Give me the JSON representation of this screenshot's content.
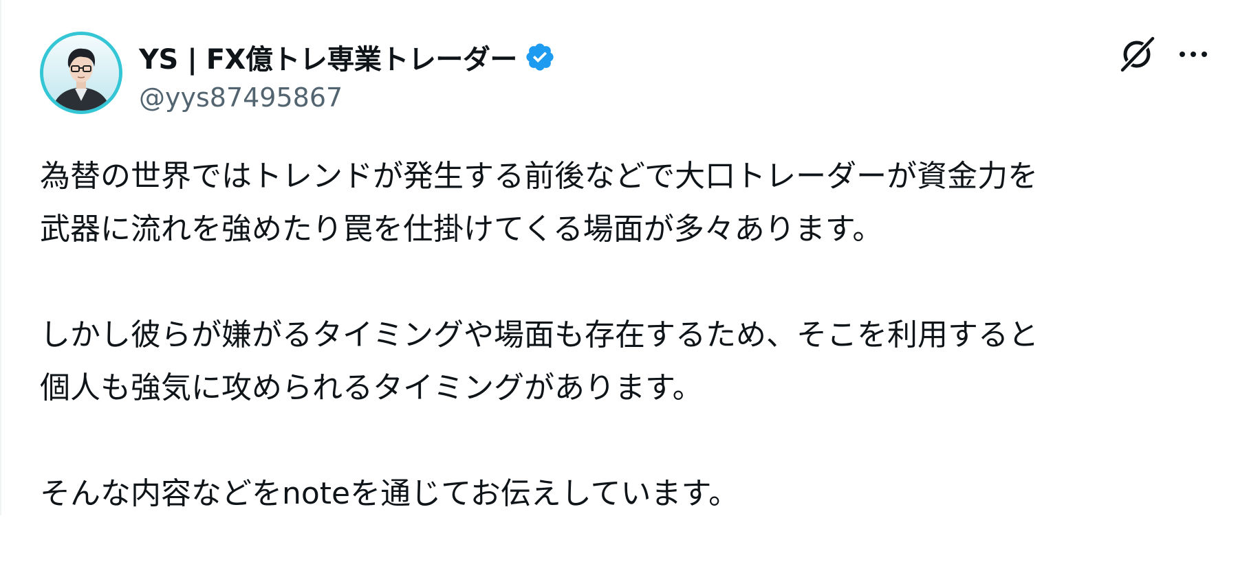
{
  "author": {
    "display_name": "YS | FX億トレ専業トレーダー",
    "handle": "@yys87495867",
    "verified": true,
    "avatar_icon": "avatar-illustration"
  },
  "actions": {
    "grok_icon": "grok-icon",
    "more_icon": "more-icon"
  },
  "post": {
    "paragraphs": [
      {
        "lines": [
          "為替の世界ではトレンドが発生する前後などで大口トレーダーが資金力を",
          "武器に流れを強めたり罠を仕掛けてくる場面が多々あります。"
        ]
      },
      {
        "lines": [
          "しかし彼らが嫌がるタイミングや場面も存在するため、そこを利用すると",
          "個人も強気に攻められるタイミングがあります。"
        ]
      },
      {
        "lines": [
          "そんな内容などをnoteを通じてお伝えしています。"
        ]
      }
    ]
  },
  "colors": {
    "text_primary": "#0f1419",
    "text_secondary": "#536471",
    "verified_blue": "#1d9bf0",
    "avatar_ring": "#35c6d6"
  }
}
